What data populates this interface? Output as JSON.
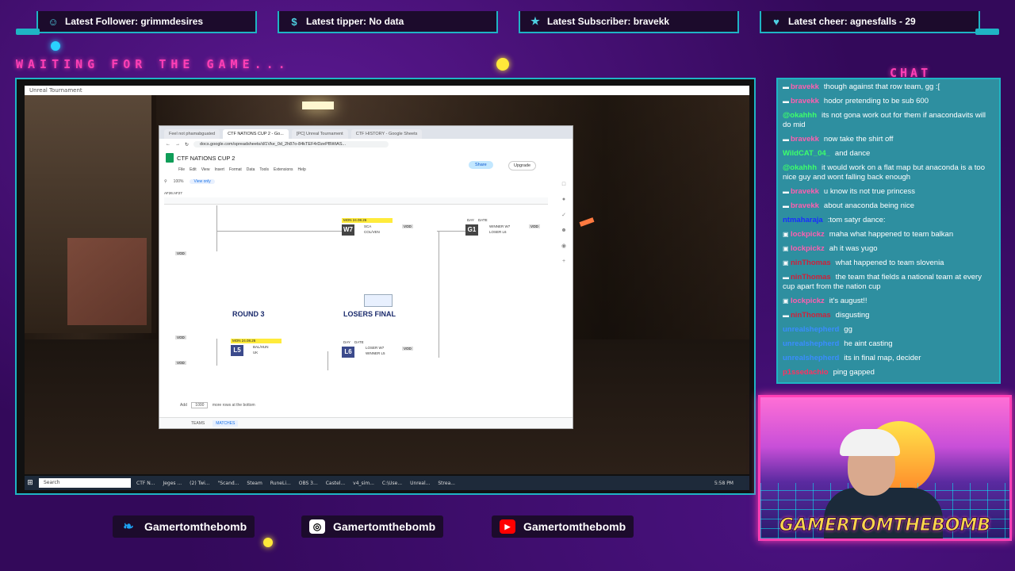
{
  "alerts": [
    {
      "icon": "follower-icon",
      "glyph": "☺",
      "text": "Latest Follower: grimmdesires"
    },
    {
      "icon": "dollar-icon",
      "glyph": "$",
      "text": "Latest tipper: No data"
    },
    {
      "icon": "star-icon",
      "glyph": "★",
      "text": "Latest Subscriber: bravekk"
    },
    {
      "icon": "heart-icon",
      "glyph": "♥",
      "text": "Latest cheer: agnesfalls - 29"
    }
  ],
  "waiting_text": "WAITING FOR THE GAME...",
  "chat_title": "CHAT",
  "game_window": {
    "title": "Unreal Tournament"
  },
  "taskbar": {
    "search": "Search",
    "items": [
      "CTF N...",
      "Jeges ...",
      "(2) Twi...",
      "\"Scand...",
      "Steam",
      "RuneLi...",
      "OBS 3...",
      "Castel...",
      "v4_sim...",
      "C:\\Use...",
      "Unreal...",
      "Strea..."
    ],
    "time": "5:58 PM"
  },
  "browser": {
    "tabs": [
      {
        "label": "Feel not phamabguated",
        "active": false
      },
      {
        "label": "CTF NATIONS CUP 2 - Go...",
        "active": true
      },
      {
        "label": "[PC] Unreal Tournament",
        "active": false
      },
      {
        "label": "CTF HISTORY - Google Sheets",
        "active": false
      }
    ],
    "url": "docs.google.com/spreadsheets/d/1Vke_0d_2h87o-84kTEF4rDzePBWtAS...",
    "doc_title": "CTF NATIONS CUP 2",
    "menu": [
      "File",
      "Edit",
      "View",
      "Insert",
      "Format",
      "Data",
      "Tools",
      "Extensions",
      "Help"
    ],
    "share": "Share",
    "upgrade": "Upgrade",
    "zoom": "100%",
    "view_only": "View only",
    "cell_ref": "AF26:AF27",
    "add_label": "Add",
    "add_count": "1000",
    "add_suffix": "more rows at the bottom",
    "sheet_tabs": [
      {
        "label": "TEAMS",
        "active": false
      },
      {
        "label": "MATCHES",
        "active": true
      }
    ]
  },
  "bracket": {
    "round3": "ROUND 3",
    "losers_final": "LOSERS FINAL",
    "w7": {
      "badge": "W7",
      "date": "MON 24.08.26",
      "teams": [
        "SCA",
        "COL/VEN"
      ],
      "vod": "VOD"
    },
    "g1": {
      "badge": "G1",
      "day": "DAY",
      "date": "DATE",
      "teams": [
        "WINNER W7",
        "LOSER L6"
      ],
      "vod": "VOD"
    },
    "l5": {
      "badge": "L5",
      "date": "MON 24.08.26",
      "teams": [
        "BAL/HUN",
        "UK"
      ]
    },
    "l6": {
      "badge": "L6",
      "day": "DAY",
      "date": "DATE",
      "teams": [
        "LOSER W7",
        "WINNER L5"
      ],
      "vod": "VOD"
    },
    "side_vod": "VOD"
  },
  "chat": [
    {
      "user": "bravekk",
      "color": "#ff5fb0",
      "icon": "twitch-icon",
      "text": "though against that row team, gg :["
    },
    {
      "user": "bravekk",
      "color": "#ff5fb0",
      "icon": "twitch-icon",
      "text": "hodor pretending to be sub 600"
    },
    {
      "user": "@okahhh",
      "color": "#3dff6a",
      "icon": "",
      "text": "its not gona work out for them if anacondavits will do mid"
    },
    {
      "user": "bravekk",
      "color": "#ff5fb0",
      "icon": "twitch-icon",
      "text": "now take the shirt off"
    },
    {
      "user": "WildCAT_04_",
      "color": "#3dff6a",
      "icon": "",
      "text": "and dance"
    },
    {
      "user": "@okahhh",
      "color": "#3dff6a",
      "icon": "",
      "text": "it would work on a flat map but anaconda is a too nice guy and wont falling back enough"
    },
    {
      "user": "bravekk",
      "color": "#ff5fb0",
      "icon": "twitch-icon",
      "text": "u know its not true princess"
    },
    {
      "user": "bravekk",
      "color": "#ff5fb0",
      "icon": "twitch-icon",
      "text": "about anaconda being nice"
    },
    {
      "user": "ntmaharaja",
      "color": "#1a2cff",
      "icon": "",
      "text": ":tom satyr dance:"
    },
    {
      "user": "lockpickz",
      "color": "#ff5fb0",
      "icon": "mod-icon",
      "text": "maha what happened to team balkan"
    },
    {
      "user": "lockpickz",
      "color": "#ff5fb0",
      "icon": "mod-icon",
      "text": "ah it was yugo"
    },
    {
      "user": "ninThomas",
      "color": "#d0203a",
      "icon": "mod-icon",
      "text": "what happened to team slovenia"
    },
    {
      "user": "ninThomas",
      "color": "#d0203a",
      "icon": "twitch-icon",
      "text": "the team that fields a national team at every cup apart from the nation cup"
    },
    {
      "user": "lockpickz",
      "color": "#ff5fb0",
      "icon": "mod-icon",
      "text": "it's august!!"
    },
    {
      "user": "ninThomas",
      "color": "#d0203a",
      "icon": "twitch-icon",
      "text": "disgusting"
    },
    {
      "user": "unrealshepherd",
      "color": "#3a8cff",
      "icon": "",
      "text": "gg"
    },
    {
      "user": "unrealshepherd",
      "color": "#3a8cff",
      "icon": "",
      "text": "he aint casting"
    },
    {
      "user": "unrealshepherd",
      "color": "#3a8cff",
      "icon": "",
      "text": "its in final map, decider"
    },
    {
      "user": "p1ssedachio",
      "color": "#ff3060",
      "icon": "",
      "text": "ping gapped"
    }
  ],
  "webcam": {
    "name": "GAMERTOMTHEBOMB"
  },
  "socials": [
    {
      "icon": "twitter-icon",
      "glyph": "❧",
      "color": "#1da1f2",
      "handle": "Gamertomthebomb"
    },
    {
      "icon": "instagram-icon",
      "glyph": "◎",
      "color": "#c13584",
      "handle": "Gamertomthebomb"
    },
    {
      "icon": "youtube-icon",
      "glyph": "▶",
      "color": "#ff0000",
      "handle": "Gamertomthebomb"
    }
  ]
}
